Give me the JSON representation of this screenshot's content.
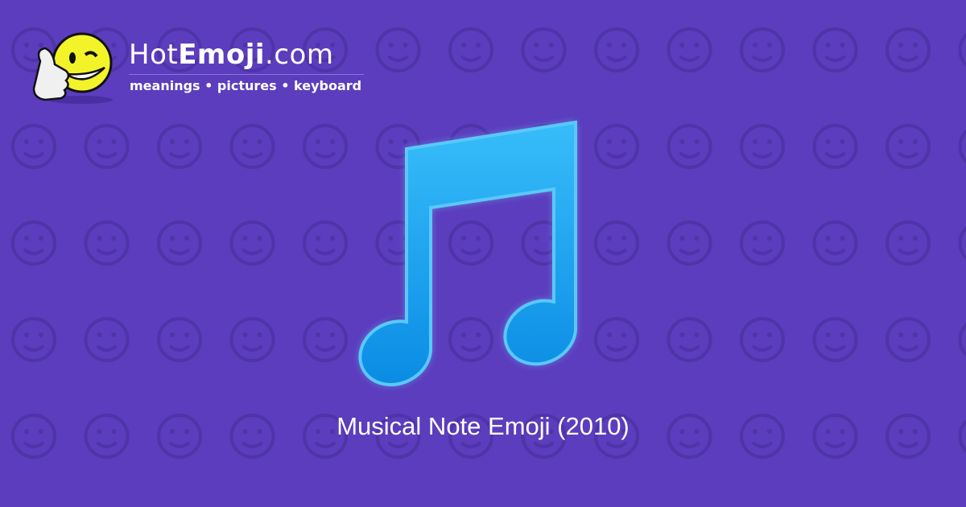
{
  "brand": {
    "prefix": "Hot",
    "bold": "Emoji",
    "suffix": ".com",
    "tagline": "meanings • pictures • keyboard"
  },
  "caption": "Musical Note Emoji (2010)",
  "colors": {
    "background": "#5b3dbd",
    "pattern": "#4f33a8",
    "note_top": "#35b6f8",
    "note_bottom": "#0a8fe6"
  }
}
